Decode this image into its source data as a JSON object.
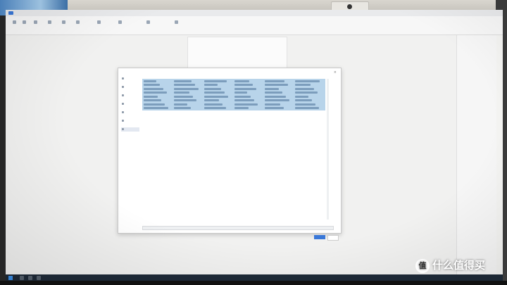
{
  "watermark": {
    "text": "什么值得买",
    "logo_glyph": "值"
  },
  "dialog": {
    "ok_label": "",
    "cancel_label": ""
  },
  "colors": {
    "accent": "#3a78d8",
    "selection": "#b8d4ea",
    "taskbar": "#1e2a38"
  }
}
